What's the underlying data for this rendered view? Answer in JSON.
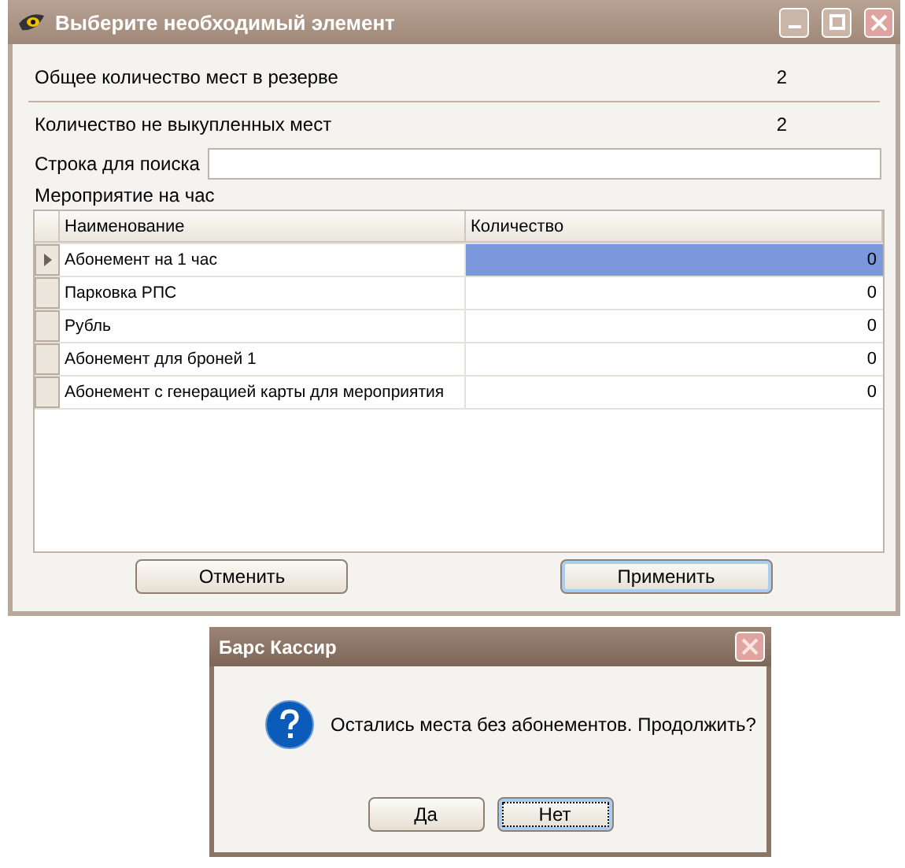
{
  "window": {
    "title": "Выберите необходимый элемент"
  },
  "summary": [
    {
      "label": "Общее количество мест в резерве",
      "value": "2"
    },
    {
      "label": "Количество не выкупленных мест",
      "value": "2"
    }
  ],
  "search": {
    "label": "Строка для поиска"
  },
  "section_title": "Мероприятие на час",
  "table": {
    "columns": [
      "Наименование",
      "Количество"
    ],
    "rows": [
      {
        "name": "Абонемент на 1 час",
        "quantity": "0",
        "selected": true
      },
      {
        "name": "Парковка РПС",
        "quantity": "0",
        "selected": false
      },
      {
        "name": "Рубль",
        "quantity": "0",
        "selected": false
      },
      {
        "name": "Абонемент для броней 1",
        "quantity": "0",
        "selected": false
      },
      {
        "name": "Абонемент с генерацией карты для мероприятия",
        "quantity": "0",
        "selected": false
      }
    ]
  },
  "buttons": [
    {
      "label": "Отменить",
      "focused": false
    },
    {
      "label": "Применить",
      "focused": true
    }
  ],
  "dialog": {
    "title": "Барс Кассир",
    "message": "Остались места без абонементов. Продолжить?",
    "buttons": [
      {
        "label": "Да",
        "focused": false
      },
      {
        "label": "Нет",
        "focused": true
      }
    ]
  }
}
